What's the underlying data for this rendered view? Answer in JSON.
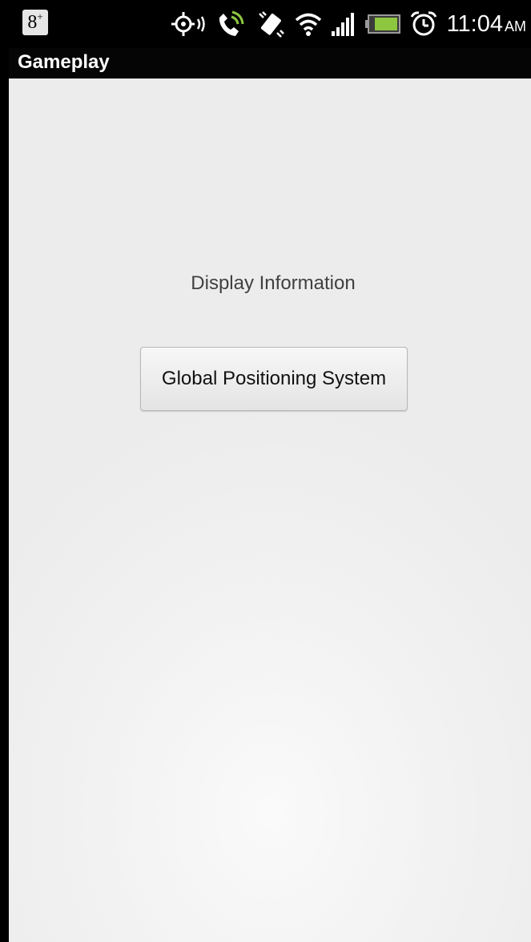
{
  "status_bar": {
    "notification_icons": [
      "google-plus-icon"
    ],
    "system_icons": [
      "gps-icon",
      "phone-call-icon",
      "vibrate-icon",
      "wifi-icon",
      "signal-icon",
      "battery-icon",
      "alarm-icon"
    ],
    "notification_badge": "8",
    "notification_badge_sup": "+",
    "time": "11:04",
    "ampm": "AM",
    "accent_color": "#8dc63f"
  },
  "action_bar": {
    "title": "Gameplay"
  },
  "content": {
    "label": "Display Information",
    "button_label": "Global Positioning System"
  }
}
